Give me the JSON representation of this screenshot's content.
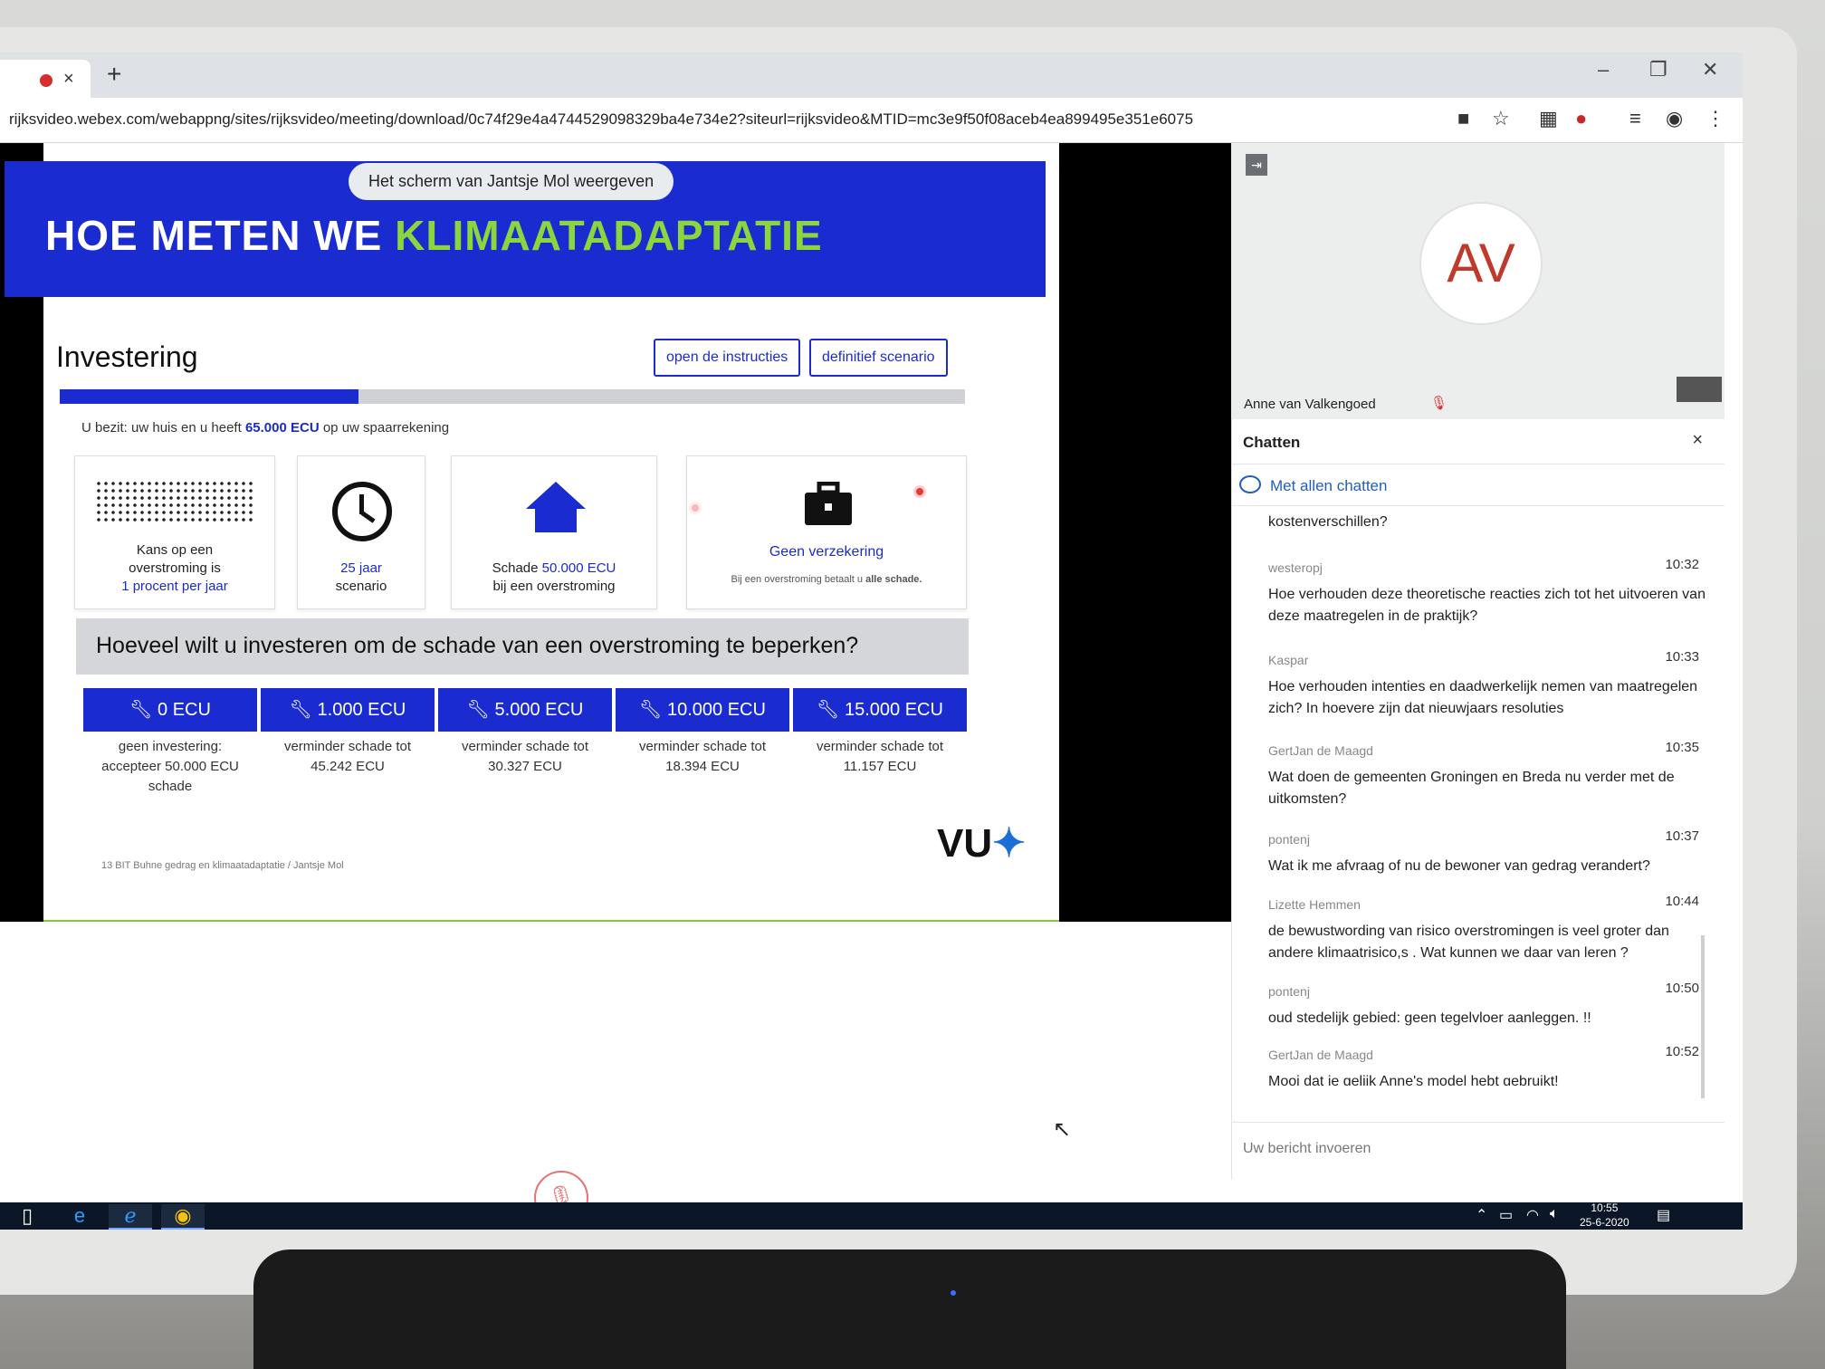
{
  "browser": {
    "url": "rijksvideo.webex.com/webappng/sites/rijksvideo/meeting/download/0c74f29e4a4744529098329ba4e734e2?siteurl=rijksvideo&MTID=mc3e9f50f08aceb4ea899495e351e6075",
    "tab_close": "×",
    "new_tab": "+",
    "window_controls": [
      "–",
      "❐",
      "✕"
    ]
  },
  "share_banner": "Het scherm van Jantsje Mol weergeven",
  "slide": {
    "title_prefix": "HOE METEN WE ",
    "title_accent": "KLIMAATADAPTATIE",
    "section": "Investering",
    "btn_instructions": "open de instructies",
    "btn_scenario": "definitief scenario",
    "progress_fraction": 0.33,
    "possession_pre": "U bezit: uw huis en u heeft",
    "possession_amount": "65.000 ECU",
    "possession_post": "op uw spaarrekening",
    "cards": {
      "chance": [
        "Kans op een",
        "overstroming is",
        "1 procent per jaar"
      ],
      "scenario": [
        "25 jaar",
        "scenario"
      ],
      "damage_pre": "Schade",
      "damage_amount": "50.000 ECU",
      "damage_post": "bij een overstroming",
      "insurance_title": "Geen verzekering",
      "insurance_note_pre": "Bij een overstroming betaalt u",
      "insurance_note_bold": "alle schade."
    },
    "question": "Hoeveel wilt u investeren om de schade van een overstroming te beperken?",
    "options": [
      {
        "label": "0 ECU",
        "desc1": "geen investering:",
        "desc2": "accepteer 50.000 ECU",
        "desc3": "schade"
      },
      {
        "label": "1.000 ECU",
        "desc1": "verminder schade tot",
        "desc2": "45.242 ECU",
        "desc3": ""
      },
      {
        "label": "5.000 ECU",
        "desc1": "verminder schade tot",
        "desc2": "30.327 ECU",
        "desc3": ""
      },
      {
        "label": "10.000 ECU",
        "desc1": "verminder schade tot",
        "desc2": "18.394 ECU",
        "desc3": ""
      },
      {
        "label": "15.000 ECU",
        "desc1": "verminder schade tot",
        "desc2": "11.157 ECU",
        "desc3": ""
      }
    ],
    "footer": "13   BIT Buhne gedrag en klimaatadaptatie / Jantsje Mol",
    "logo": "VU"
  },
  "participant": {
    "initials": "AV",
    "name": "Anne van Valkengoed"
  },
  "chat": {
    "title": "Chatten",
    "close": "×",
    "with_all": "Met allen chatten",
    "partial_top": "kostenverschillen?",
    "messages": [
      {
        "sender": "westeropj",
        "time": "10:32",
        "text": "Hoe verhouden deze theoretische reacties zich tot het uitvoeren van deze maatregelen in de praktijk?"
      },
      {
        "sender": "Kaspar",
        "time": "10:33",
        "text": "Hoe verhouden intenties en daadwerkelijk nemen van maatregelen zich? In hoevere zijn dat nieuwjaars resoluties"
      },
      {
        "sender": "GertJan de Maagd",
        "time": "10:35",
        "text": "Wat doen de gemeenten Groningen en Breda nu verder met de uitkomsten?"
      },
      {
        "sender": "pontenj",
        "time": "10:37",
        "text": "Wat ik me afvraag of nu de bewoner van gedrag verandert?"
      },
      {
        "sender": "Lizette Hemmen",
        "time": "10:44",
        "text": "de bewustwording van risico overstromingen is veel groter dan andere klimaatrisico,s . Wat kunnen we daar van leren ?"
      },
      {
        "sender": "pontenj",
        "time": "10:50",
        "text": "oud stedelijk gebied: geen tegelvloer aanleggen. !!"
      },
      {
        "sender": "GertJan de Maagd",
        "time": "10:52",
        "text": "Mooi dat je gelijk Anne's model hebt gebruikt!"
      }
    ],
    "input_placeholder": "Uw bericht invoeren"
  },
  "taskbar": {
    "time": "10:55",
    "date": "25-6-2020"
  }
}
